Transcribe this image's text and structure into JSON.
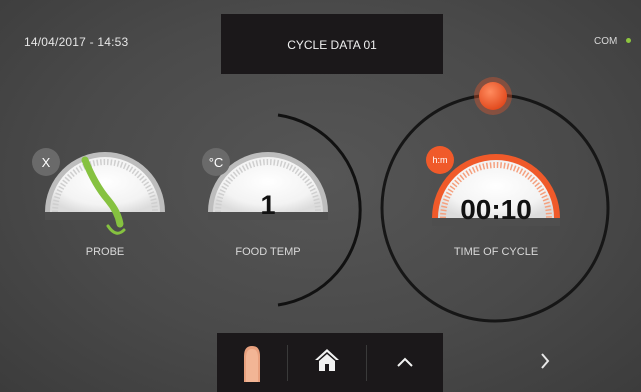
{
  "header": {
    "datetime": "14/04/2017 - 14:53",
    "title": "CYCLE DATA 01",
    "com_label": "COM",
    "com_status_color": "#8ec63f"
  },
  "dials": {
    "probe": {
      "badge": "X",
      "label": "PROBE",
      "icon": "probe-icon"
    },
    "food_temp": {
      "badge": "°C",
      "value": "1",
      "label": "FOOD TEMP"
    },
    "time_of_cycle": {
      "badge": "h:m",
      "value": "00:10",
      "label": "TIME OF CYCLE",
      "accent": "#f05a2a"
    }
  },
  "nav": {
    "back_icon": "back-icon",
    "home_icon": "home-icon",
    "up_icon": "chevron-up-icon",
    "next_icon": "chevron-right-icon"
  }
}
